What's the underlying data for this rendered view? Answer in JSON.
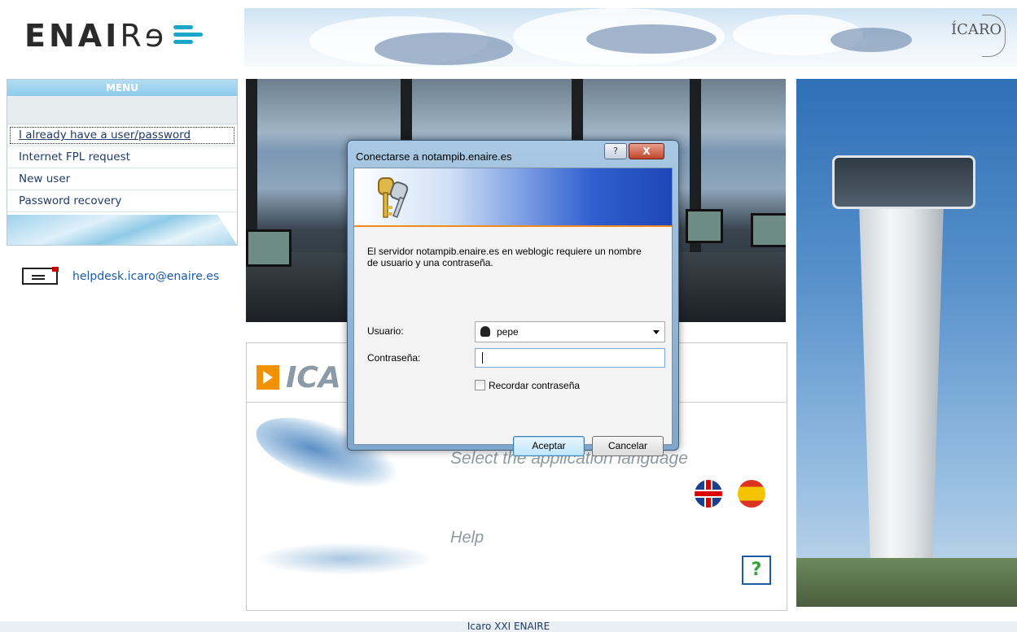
{
  "header": {
    "logo_bold": "ENAI",
    "logo_light": "Rɘ",
    "icaro_logo": "ÍCARO"
  },
  "menu": {
    "title": "MENU",
    "items": [
      {
        "label": "I already have a user/password",
        "active": true
      },
      {
        "label": "Internet FPL request",
        "active": false
      },
      {
        "label": "New user",
        "active": false
      },
      {
        "label": "Password recovery",
        "active": false
      }
    ]
  },
  "helpdesk": {
    "email": "helpdesk.icaro@enaire.es",
    "icon": "envelope-icon"
  },
  "language_panel": {
    "brand": "ICA",
    "select_label": "Select the application language",
    "help_label": "Help",
    "help_button": "?",
    "flags": [
      "uk-flag-icon",
      "spain-flag-icon"
    ]
  },
  "dialog": {
    "title": "Conectarse a notampib.enaire.es",
    "help_button": "?",
    "close_button": "X",
    "message": "El servidor notampib.enaire.es en weblogic requiere un nombre de usuario y una contraseña.",
    "user_label": "Usuario:",
    "user_value": "pepe",
    "password_label": "Contraseña:",
    "password_value": "",
    "remember_label": "Recordar contraseña",
    "ok_label": "Aceptar",
    "cancel_label": "Cancelar"
  },
  "footer": {
    "text": "Icaro XXI ENAIRE"
  },
  "colors": {
    "link": "#1f5aa8",
    "menu_text": "#1f3a6b",
    "accent_orange": "#f39200",
    "menu_header": "#8fcbea"
  }
}
